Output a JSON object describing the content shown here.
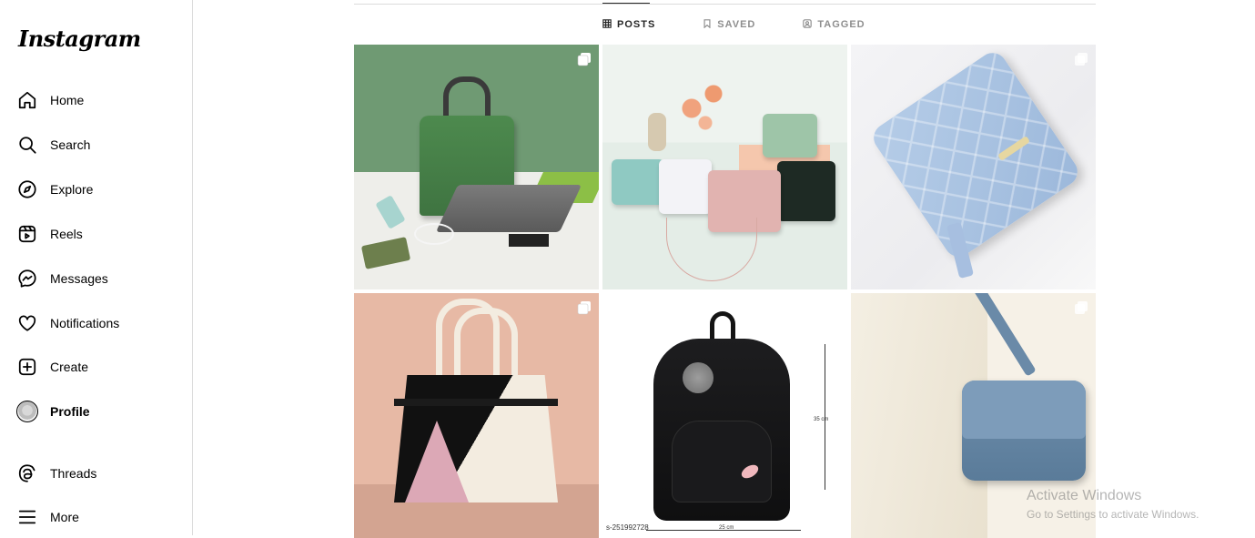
{
  "brand": {
    "logo_text": "Instagram"
  },
  "sidebar": {
    "items": [
      {
        "label": "Home",
        "icon": "home-icon"
      },
      {
        "label": "Search",
        "icon": "search-icon"
      },
      {
        "label": "Explore",
        "icon": "compass-icon"
      },
      {
        "label": "Reels",
        "icon": "reels-icon"
      },
      {
        "label": "Messages",
        "icon": "messenger-icon"
      },
      {
        "label": "Notifications",
        "icon": "heart-icon"
      },
      {
        "label": "Create",
        "icon": "plus-square-icon"
      },
      {
        "label": "Profile",
        "icon": "avatar",
        "active": true
      },
      {
        "label": "Threads",
        "icon": "threads-icon"
      },
      {
        "label": "More",
        "icon": "hamburger-icon"
      }
    ]
  },
  "profile_tabs": [
    {
      "label": "POSTS",
      "icon": "grid-icon",
      "active": true
    },
    {
      "label": "SAVED",
      "icon": "bookmark-icon"
    },
    {
      "label": "TAGGED",
      "icon": "tagged-icon"
    }
  ],
  "posts": [
    {
      "subject": "green laptop bag",
      "multiple": true
    },
    {
      "subject": "pastel crossbody bags",
      "multiple": false
    },
    {
      "subject": "blue quilted wallet",
      "multiple": true
    },
    {
      "subject": "black and white tote",
      "multiple": true
    },
    {
      "subject": "black backpack",
      "multiple": false,
      "caption_code": "s-251992728",
      "width_label": "25 cm",
      "height_label": "35 cm"
    },
    {
      "subject": "blue shoulder bag",
      "multiple": true
    }
  ],
  "watermark": {
    "line1": "Activate Windows",
    "line2": "Go to Settings to activate Windows."
  },
  "colors": {
    "accent": "#262626",
    "muted": "#8e8e8e",
    "border": "#dbdbdb"
  }
}
